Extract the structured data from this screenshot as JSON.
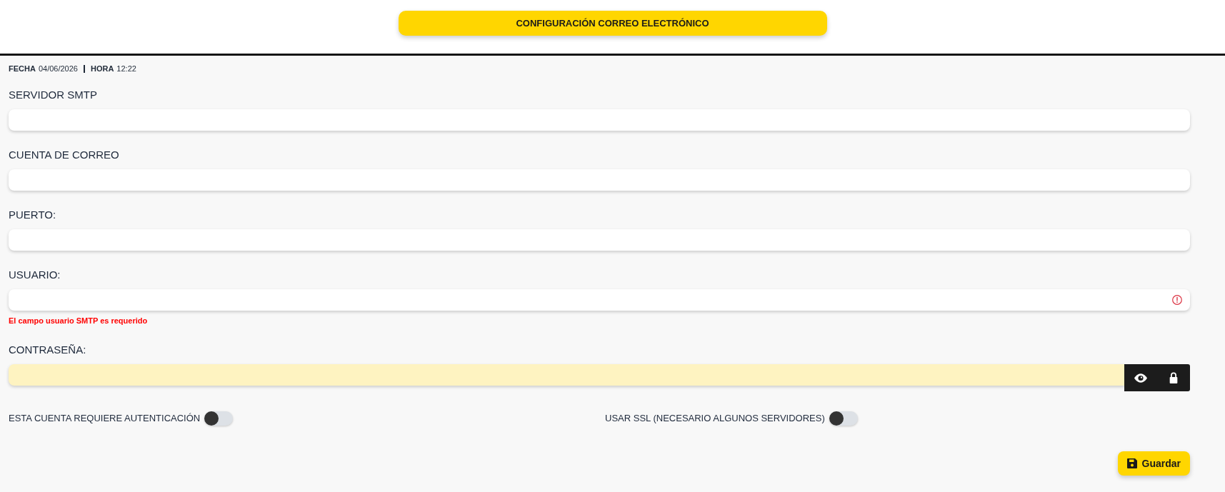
{
  "header": {
    "title": "CONFIGURACIÓN CORREO ELECTRÓNICO"
  },
  "datetime": [
    {
      "label": "FECHA",
      "value": "04/06/2026"
    },
    {
      "label": "HORA",
      "value": "12:22"
    }
  ],
  "fields": [
    {
      "kind": "text",
      "label": "SERVIDOR SMTP"
    },
    {
      "kind": "text",
      "label": "CUENTA DE CORREO"
    },
    {
      "kind": "text",
      "label": "PUERTO:"
    },
    {
      "kind": "text",
      "label": "USUARIO:",
      "error": "El campo usuario SMTP es requerido"
    },
    {
      "kind": "password",
      "label": "CONTRASEÑA:"
    }
  ],
  "toggles": [
    {
      "label": "ESTA CUENTA REQUIERE AUTENTICACIÓN",
      "on": false
    },
    {
      "label": "USAR SSL (NECESARIO ALGUNOS SERVIDORES)",
      "on": false
    }
  ],
  "save_button": {
    "label": "Guardar"
  }
}
